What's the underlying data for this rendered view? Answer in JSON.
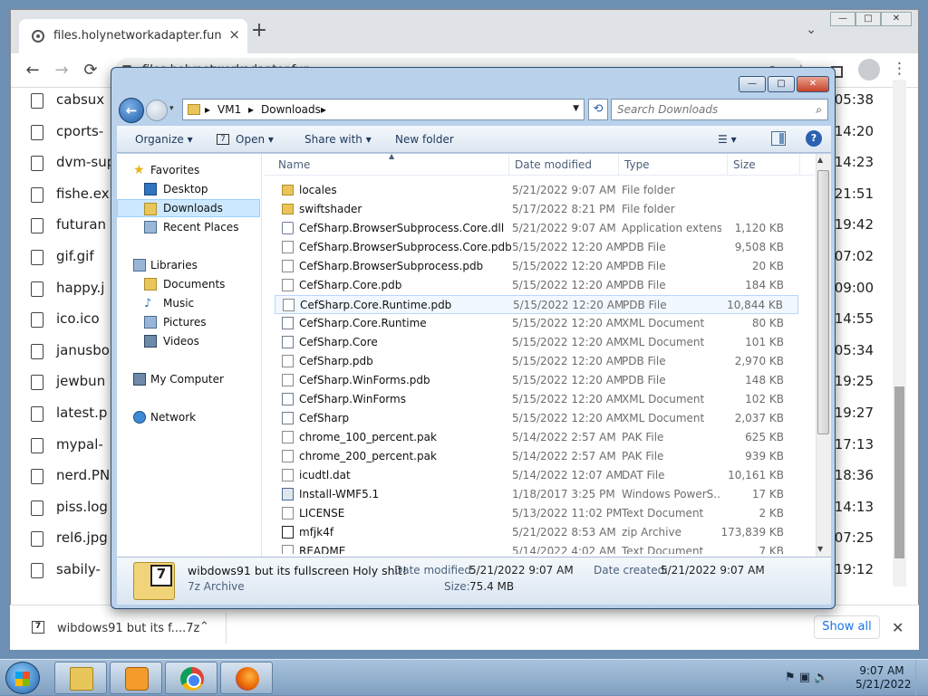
{
  "browser": {
    "tab_title": "files.holynetworkadapter.fun",
    "tab_close": "×",
    "new_tab": "+",
    "tab_menu": "⌄",
    "url": "files.holynetworkadapter.fun",
    "back": "←",
    "forward": "→",
    "reload": "⟳",
    "share_icon": "⇗",
    "star_icon": "☆",
    "menu_icon": "⋮",
    "win_min": "—",
    "win_max": "□",
    "win_close": "✕"
  },
  "page_list": [
    {
      "name": "cabsux",
      "time": "05:38"
    },
    {
      "name": "cports-",
      "time": "14:20"
    },
    {
      "name": "dvm-sup",
      "time": "14:23"
    },
    {
      "name": "fishe.ex",
      "time": "21:51"
    },
    {
      "name": "futuran",
      "time": "19:42"
    },
    {
      "name": "gif.gif",
      "time": "07:02"
    },
    {
      "name": "happy.j",
      "time": "09:00"
    },
    {
      "name": "ico.ico",
      "time": "14:55"
    },
    {
      "name": "janusbo",
      "time": "05:34"
    },
    {
      "name": "jewbun",
      "time": "19:25"
    },
    {
      "name": "latest.p",
      "time": "19:27"
    },
    {
      "name": "mypal-",
      "time": "17:13"
    },
    {
      "name": "nerd.PN",
      "time": "18:36"
    },
    {
      "name": "piss.log",
      "time": "14:13"
    },
    {
      "name": "rel6.jpg",
      "time": "07:25"
    },
    {
      "name": "sabily-",
      "time": "19:12"
    }
  ],
  "download_bar": {
    "file": "wibdows91 but its f....7z",
    "chevron": "⌃",
    "show_all": "Show all",
    "close": "✕"
  },
  "explorer": {
    "caption_min": "—",
    "caption_max": "□",
    "caption_close": "✕",
    "back": "←",
    "breadcrumb": [
      "VM1",
      "Downloads"
    ],
    "breadcrumb_sep": "▸",
    "search_placeholder": "Search Downloads",
    "toolbar": {
      "organize": "Organize ▾",
      "open": "Open ▾",
      "share_with": "Share with ▾",
      "new_folder": "New folder",
      "views": "☰ ▾",
      "help": "?"
    },
    "nav": {
      "favorites": "Favorites",
      "desktop": "Desktop",
      "downloads": "Downloads",
      "recent_places": "Recent Places",
      "libraries": "Libraries",
      "documents": "Documents",
      "music": "Music",
      "pictures": "Pictures",
      "videos": "Videos",
      "my_computer": "My Computer",
      "network": "Network"
    },
    "columns": {
      "name": "Name",
      "date": "Date modified",
      "type": "Type",
      "size": "Size"
    },
    "files": [
      {
        "name": "locales",
        "date": "5/21/2022 9:07 AM",
        "type": "File folder",
        "size": "",
        "icon": "folder"
      },
      {
        "name": "swiftshader",
        "date": "5/17/2022 8:21 PM",
        "type": "File folder",
        "size": "",
        "icon": "folder"
      },
      {
        "name": "CefSharp.BrowserSubprocess.Core.dll",
        "date": "5/21/2022 9:07 AM",
        "type": "Application extens...",
        "size": "1,120 KB",
        "icon": "gear"
      },
      {
        "name": "CefSharp.BrowserSubprocess.Core.pdb",
        "date": "5/15/2022 12:20 AM",
        "type": "PDB File",
        "size": "9,508 KB",
        "icon": "doc"
      },
      {
        "name": "CefSharp.BrowserSubprocess.pdb",
        "date": "5/15/2022 12:20 AM",
        "type": "PDB File",
        "size": "20 KB",
        "icon": "doc"
      },
      {
        "name": "CefSharp.Core.pdb",
        "date": "5/15/2022 12:20 AM",
        "type": "PDB File",
        "size": "184 KB",
        "icon": "doc"
      },
      {
        "name": "CefSharp.Core.Runtime.pdb",
        "date": "5/15/2022 12:20 AM",
        "type": "PDB File",
        "size": "10,844 KB",
        "icon": "doc"
      },
      {
        "name": "CefSharp.Core.Runtime",
        "date": "5/15/2022 12:20 AM",
        "type": "XML Document",
        "size": "80 KB",
        "icon": "xml"
      },
      {
        "name": "CefSharp.Core",
        "date": "5/15/2022 12:20 AM",
        "type": "XML Document",
        "size": "101 KB",
        "icon": "xml"
      },
      {
        "name": "CefSharp.pdb",
        "date": "5/15/2022 12:20 AM",
        "type": "PDB File",
        "size": "2,970 KB",
        "icon": "doc"
      },
      {
        "name": "CefSharp.WinForms.pdb",
        "date": "5/15/2022 12:20 AM",
        "type": "PDB File",
        "size": "148 KB",
        "icon": "doc"
      },
      {
        "name": "CefSharp.WinForms",
        "date": "5/15/2022 12:20 AM",
        "type": "XML Document",
        "size": "102 KB",
        "icon": "xml"
      },
      {
        "name": "CefSharp",
        "date": "5/15/2022 12:20 AM",
        "type": "XML Document",
        "size": "2,037 KB",
        "icon": "xml"
      },
      {
        "name": "chrome_100_percent.pak",
        "date": "5/14/2022 2:57 AM",
        "type": "PAK File",
        "size": "625 KB",
        "icon": "doc"
      },
      {
        "name": "chrome_200_percent.pak",
        "date": "5/14/2022 2:57 AM",
        "type": "PAK File",
        "size": "939 KB",
        "icon": "doc"
      },
      {
        "name": "icudtl.dat",
        "date": "5/14/2022 12:07 AM",
        "type": "DAT File",
        "size": "10,161 KB",
        "icon": "doc"
      },
      {
        "name": "Install-WMF5.1",
        "date": "1/18/2017 3:25 PM",
        "type": "Windows PowerS...",
        "size": "17 KB",
        "icon": "ps"
      },
      {
        "name": "LICENSE",
        "date": "5/13/2022 11:02 PM",
        "type": "Text Document",
        "size": "2 KB",
        "icon": "doc"
      },
      {
        "name": "mfjk4f",
        "date": "5/21/2022 8:53 AM",
        "type": "zip Archive",
        "size": "173,839 KB",
        "icon": "zip"
      },
      {
        "name": "README",
        "date": "5/14/2022 4:02 AM",
        "type": "Text Document",
        "size": "7 KB",
        "icon": "doc"
      }
    ],
    "details": {
      "name": "wibdows91 but its fullscreen Holy shit!",
      "type": "7z Archive",
      "modified_label": "Date modified:",
      "modified": "5/21/2022 9:07 AM",
      "created_label": "Date created:",
      "created": "5/21/2022 9:07 AM",
      "size_label": "Size:",
      "size": "75.4 MB"
    }
  },
  "taskbar": {
    "tray_icons": "⚑ ▣ 🔈",
    "time": "9:07 AM",
    "date": "5/21/2022"
  }
}
